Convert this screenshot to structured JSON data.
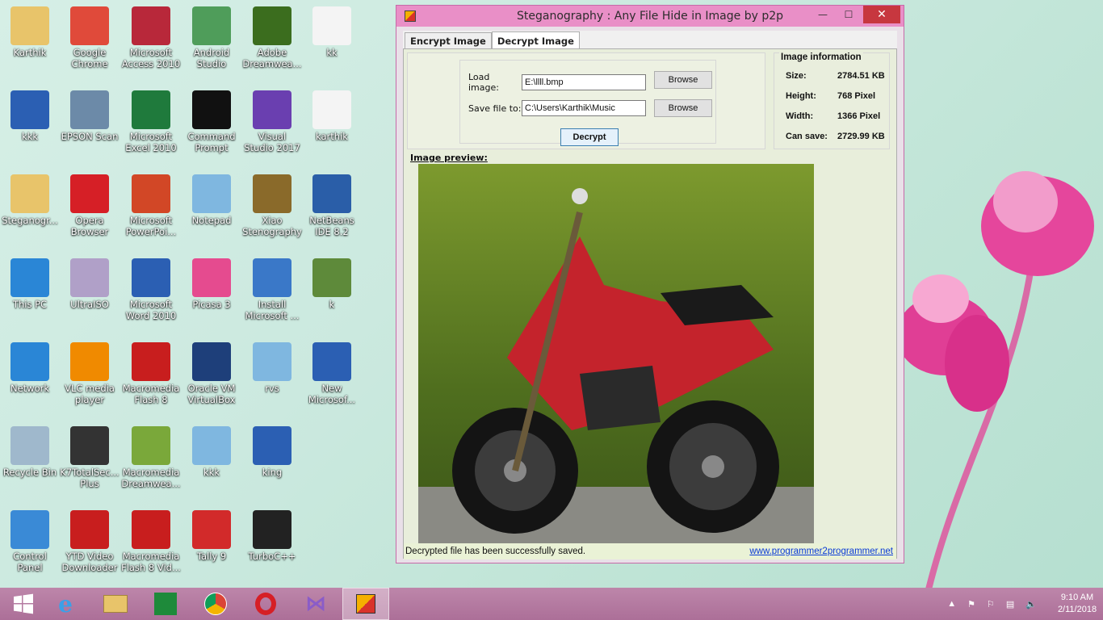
{
  "desktop": {
    "icons": [
      {
        "label": "Karthik",
        "name": "karthik-folder-icon",
        "x": 0,
        "y": 0,
        "color": "#e8c46a"
      },
      {
        "label": "Google Chrome",
        "name": "chrome-icon",
        "x": 1,
        "y": 0,
        "color": "#e04a3a"
      },
      {
        "label": "Microsoft Access 2010",
        "name": "access-icon",
        "x": 2,
        "y": 0,
        "color": "#b8283a"
      },
      {
        "label": "Android Studio",
        "name": "android-studio-icon",
        "x": 3,
        "y": 0,
        "color": "#4f9d5a"
      },
      {
        "label": "Adobe Dreamwea...",
        "name": "dreamweaver-icon",
        "x": 4,
        "y": 0,
        "color": "#3b6d1e"
      },
      {
        "label": "kk",
        "name": "kk-image-icon",
        "x": 5,
        "y": 0,
        "color": "#f4f4f4"
      },
      {
        "label": "kkk",
        "name": "kkk-word-icon",
        "x": 0,
        "y": 1,
        "color": "#2b5fb3"
      },
      {
        "label": "EPSON Scan",
        "name": "epson-scan-icon",
        "x": 1,
        "y": 1,
        "color": "#6c8aa8"
      },
      {
        "label": "Microsoft Excel 2010",
        "name": "excel-icon",
        "x": 2,
        "y": 1,
        "color": "#1f7a3c"
      },
      {
        "label": "Command Prompt",
        "name": "command-prompt-icon",
        "x": 3,
        "y": 1,
        "color": "#111111"
      },
      {
        "label": "Visual Studio 2017",
        "name": "visual-studio-icon",
        "x": 4,
        "y": 1,
        "color": "#6a3fb0"
      },
      {
        "label": "karthik",
        "name": "karthik-image-icon",
        "x": 5,
        "y": 1,
        "color": "#f4f4f4"
      },
      {
        "label": "Steganogr...",
        "name": "steganography-folder-icon",
        "x": 0,
        "y": 2,
        "color": "#e8c46a"
      },
      {
        "label": "Opera Browser",
        "name": "opera-icon",
        "x": 1,
        "y": 2,
        "color": "#d61f26"
      },
      {
        "label": "Microsoft PowerPoi...",
        "name": "powerpoint-icon",
        "x": 2,
        "y": 2,
        "color": "#d24726"
      },
      {
        "label": "Notepad",
        "name": "notepad-icon",
        "x": 3,
        "y": 2,
        "color": "#7fb7e0"
      },
      {
        "label": "Xiao Stenography",
        "name": "xiao-stenography-icon",
        "x": 4,
        "y": 2,
        "color": "#8a6a2a"
      },
      {
        "label": "NetBeans IDE 8.2",
        "name": "netbeans-icon",
        "x": 5,
        "y": 2,
        "color": "#2a5ea8"
      },
      {
        "label": "This PC",
        "name": "this-pc-icon",
        "x": 0,
        "y": 3,
        "color": "#2a86d6"
      },
      {
        "label": "UltraISO",
        "name": "ultraiso-icon",
        "x": 1,
        "y": 3,
        "color": "#b0a0c8"
      },
      {
        "label": "Microsoft Word 2010",
        "name": "word-icon",
        "x": 2,
        "y": 3,
        "color": "#2b5fb3"
      },
      {
        "label": "Picasa 3",
        "name": "picasa-icon",
        "x": 3,
        "y": 3,
        "color": "#e54b8f"
      },
      {
        "label": "Install Microsoft ...",
        "name": "install-microsoft-icon",
        "x": 4,
        "y": 3,
        "color": "#3a78c8"
      },
      {
        "label": "k",
        "name": "k-image-icon",
        "x": 5,
        "y": 3,
        "color": "#5e8a3a"
      },
      {
        "label": "Network",
        "name": "network-icon",
        "x": 0,
        "y": 4,
        "color": "#2a86d6"
      },
      {
        "label": "VLC media player",
        "name": "vlc-icon",
        "x": 1,
        "y": 4,
        "color": "#f08a00"
      },
      {
        "label": "Macromedia Flash 8",
        "name": "flash-icon",
        "x": 2,
        "y": 4,
        "color": "#c81e1e"
      },
      {
        "label": "Oracle VM VirtualBox",
        "name": "virtualbox-icon",
        "x": 3,
        "y": 4,
        "color": "#1e3f7a"
      },
      {
        "label": "rvs",
        "name": "rvs-notepad-icon",
        "x": 4,
        "y": 4,
        "color": "#7fb7e0"
      },
      {
        "label": "New Microsof...",
        "name": "new-word-doc-icon",
        "x": 5,
        "y": 4,
        "color": "#2b5fb3"
      },
      {
        "label": "Recycle Bin",
        "name": "recycle-bin-icon",
        "x": 0,
        "y": 5,
        "color": "#9fb8cc"
      },
      {
        "label": "K7TotalSec... Plus",
        "name": "k7-icon",
        "x": 1,
        "y": 5,
        "color": "#333333"
      },
      {
        "label": "Macromedia Dreamwea...",
        "name": "macromedia-dreamweaver-icon",
        "x": 2,
        "y": 5,
        "color": "#7aa83a"
      },
      {
        "label": "kkk",
        "name": "kkk-notepad-icon",
        "x": 3,
        "y": 5,
        "color": "#7fb7e0"
      },
      {
        "label": "king",
        "name": "king-word-icon",
        "x": 4,
        "y": 5,
        "color": "#2b5fb3"
      },
      {
        "label": "Control Panel",
        "name": "control-panel-icon",
        "x": 0,
        "y": 6,
        "color": "#3a8ad6"
      },
      {
        "label": "YTD Video Downloader",
        "name": "ytd-icon",
        "x": 1,
        "y": 6,
        "color": "#c81e1e"
      },
      {
        "label": "Macromedia Flash 8 Vid...",
        "name": "flash-video-icon",
        "x": 2,
        "y": 6,
        "color": "#c81e1e"
      },
      {
        "label": "Tally 9",
        "name": "tally-icon",
        "x": 3,
        "y": 6,
        "color": "#d22a2a"
      },
      {
        "label": "TurboC++",
        "name": "turboc-icon",
        "x": 4,
        "y": 6,
        "color": "#222222"
      }
    ]
  },
  "window": {
    "title": "Steganography : Any File Hide in Image by p2p",
    "minimize": "—",
    "maximize": "☐",
    "close": "✕",
    "tabs": [
      {
        "label": "Encrypt Image"
      },
      {
        "label": "Decrypt Image"
      }
    ],
    "form": {
      "load_label": "Load image:",
      "load_value": "E:\\llll.bmp",
      "save_label": "Save file to:",
      "save_value": "C:\\Users\\Karthik\\Music",
      "browse1": "Browse",
      "browse2": "Browse",
      "decrypt": "Decrypt"
    },
    "info": {
      "heading": "Image information",
      "rows": [
        {
          "k": "Size:",
          "v": "2784.51 KB"
        },
        {
          "k": "Height:",
          "v": "768 Pixel"
        },
        {
          "k": "Width:",
          "v": "1366 Pixel"
        },
        {
          "k": "Can save:",
          "v": "2729.99 KB"
        }
      ]
    },
    "preview_label": "Image preview:",
    "status_text": "Decrypted file has been successfully saved.",
    "link_text": "www.programmer2programmer.net"
  },
  "taskbar": {
    "clock_time": "9:10 AM",
    "clock_date": "2/11/2018"
  }
}
